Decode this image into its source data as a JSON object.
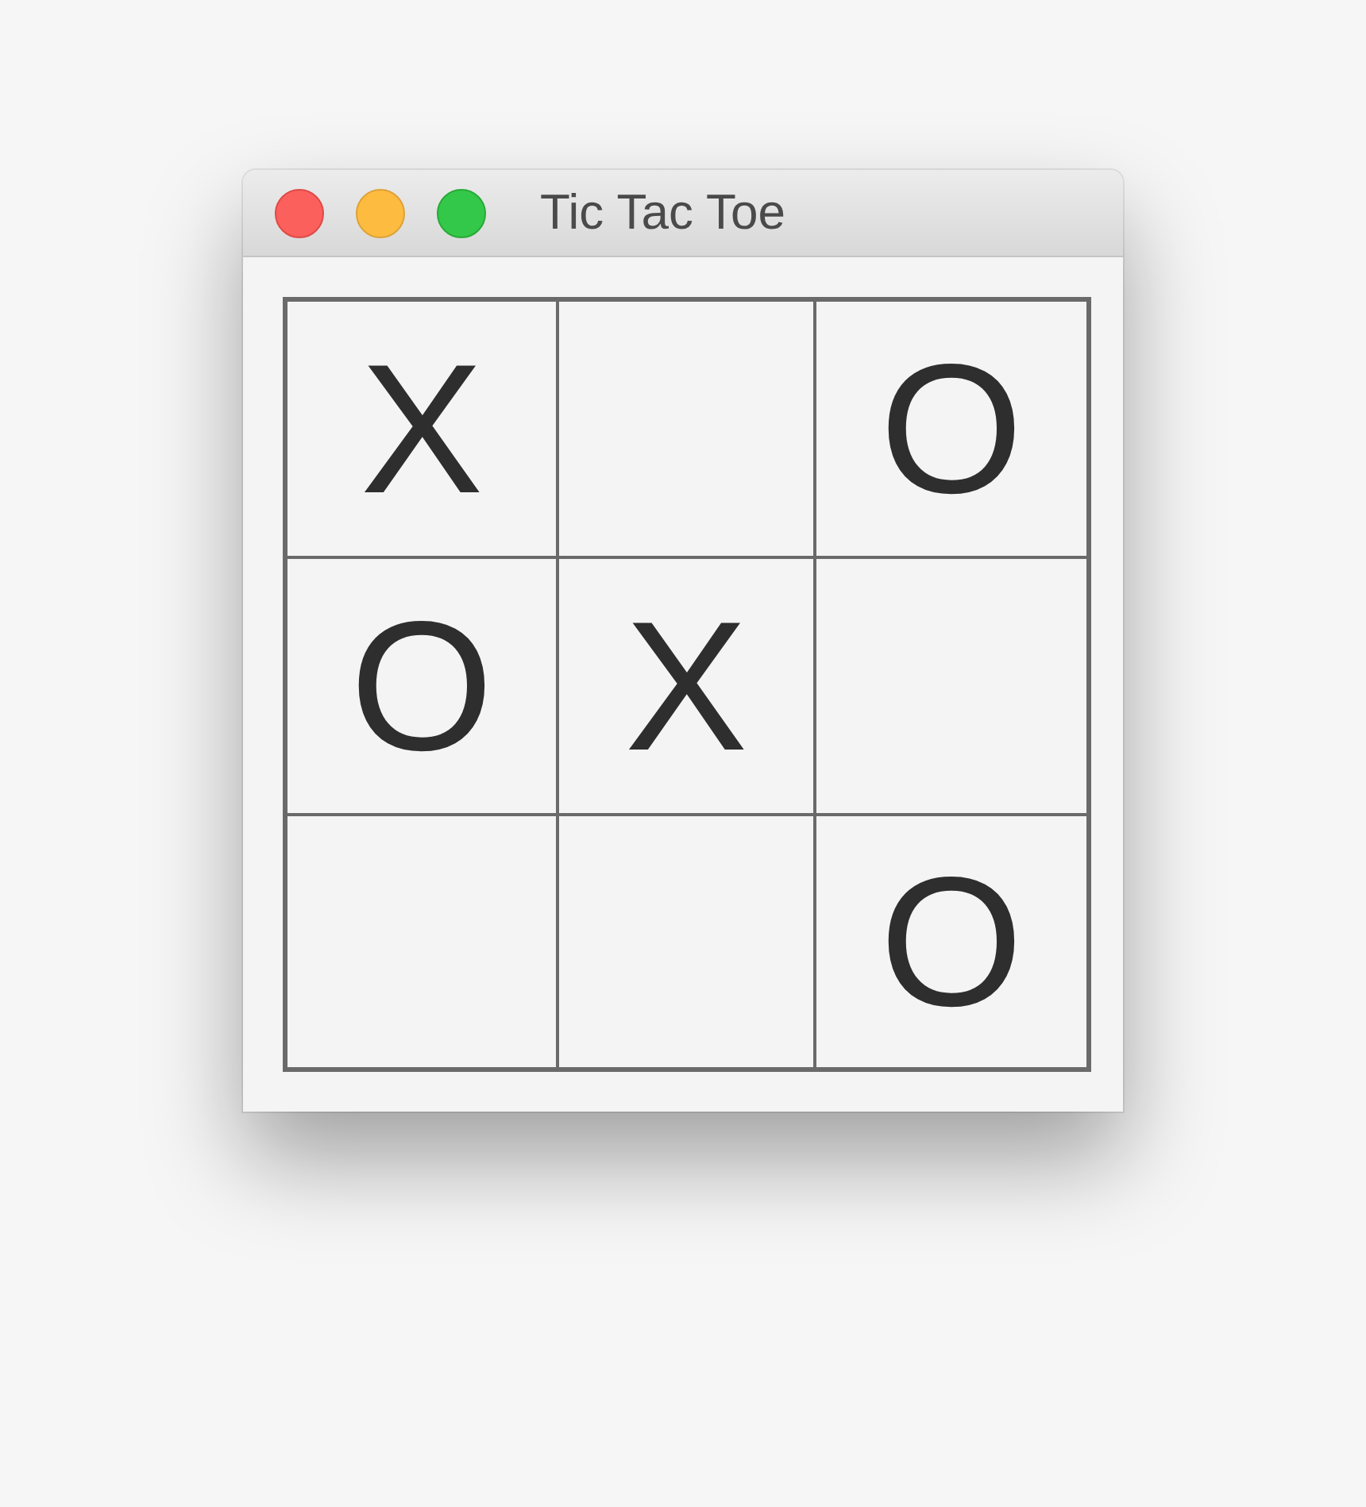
{
  "window": {
    "title": "Tic Tac Toe"
  },
  "board": {
    "cells": [
      {
        "mark": "X"
      },
      {},
      {
        "mark": "O"
      },
      {
        "mark": "O"
      },
      {
        "mark": "X"
      },
      {},
      {},
      {},
      {
        "mark": "O"
      }
    ]
  }
}
